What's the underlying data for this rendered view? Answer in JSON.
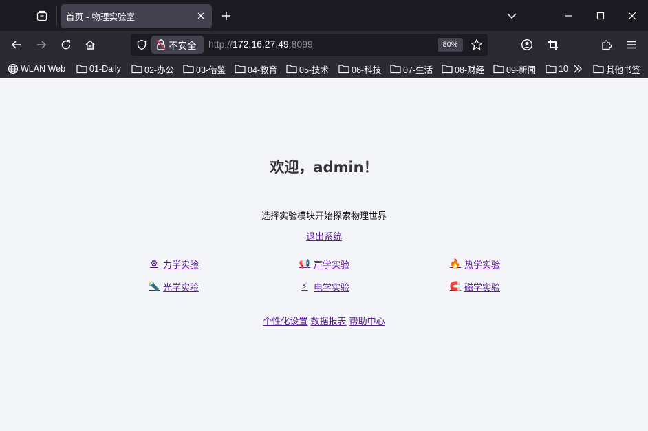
{
  "browser": {
    "tab_title": "首页 - 物理实验室",
    "security_label": "不安全",
    "url_prefix": "http://",
    "url_host": "172.16.27.49",
    "url_port": ":8099",
    "zoom": "80%",
    "bookmarks": [
      {
        "label": "WLAN Web",
        "icon": "globe-icon"
      },
      {
        "label": "01-Daily",
        "icon": "folder-icon"
      },
      {
        "label": "02-办公",
        "icon": "folder-icon"
      },
      {
        "label": "03-借鉴",
        "icon": "folder-icon"
      },
      {
        "label": "04-教育",
        "icon": "folder-icon"
      },
      {
        "label": "05-技术",
        "icon": "folder-icon"
      },
      {
        "label": "06-科技",
        "icon": "folder-icon"
      },
      {
        "label": "07-生活",
        "icon": "folder-icon"
      },
      {
        "label": "08-财经",
        "icon": "folder-icon"
      },
      {
        "label": "09-新闻",
        "icon": "folder-icon"
      },
      {
        "label": "10",
        "icon": "folder-icon"
      }
    ],
    "other_bookmarks": "其他书签"
  },
  "page": {
    "welcome": "欢迎，admin！",
    "subtitle": "选择实验模块开始探索物理世界",
    "logout": "退出系统",
    "modules": [
      {
        "label": "力学实验",
        "icon": "⚙"
      },
      {
        "label": "声学实验",
        "icon": "📢"
      },
      {
        "label": "热学实验",
        "icon": "🔥"
      },
      {
        "label": "光学实验",
        "icon": "🔦"
      },
      {
        "label": "电学实验",
        "icon": "⚡"
      },
      {
        "label": "磁学实验",
        "icon": "🧲"
      }
    ],
    "footer": {
      "settings": "个性化设置",
      "reports": "数据报表",
      "help": "帮助中心"
    }
  }
}
